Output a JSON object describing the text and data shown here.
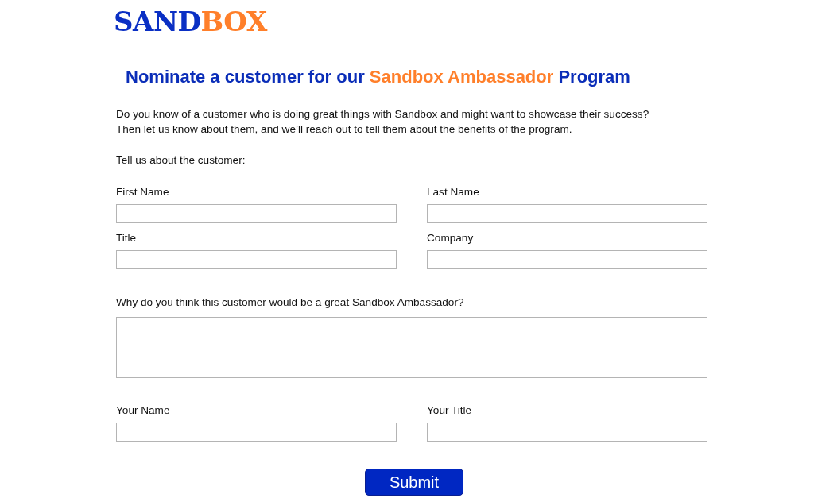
{
  "logo": {
    "parts": [
      {
        "text": "SAND",
        "kind": "primary"
      },
      {
        "text": "BOX",
        "kind": "accent"
      }
    ]
  },
  "heading": {
    "parts": [
      {
        "text": "Nominate a customer for our ",
        "kind": "primary"
      },
      {
        "text": "Sandbox Ambassador",
        "kind": "accent"
      },
      {
        "text": " Program",
        "kind": "primary"
      }
    ]
  },
  "intro": [
    "Do you know of a customer who is doing great things with Sandbox and might want to showcase their success?",
    "Then let us know about them, and we’ll reach out to tell them about the benefits of the program."
  ],
  "customer_section": {
    "title": "Tell us about the customer:",
    "fields": [
      {
        "label": "First Name"
      },
      {
        "label": "Last Name"
      },
      {
        "label": "Title"
      },
      {
        "label": "Company"
      }
    ]
  },
  "question": {
    "label": "Why do you think this customer would be a great Sandbox Ambassador?"
  },
  "nominator_fields": [
    {
      "label": "Your Name"
    },
    {
      "label": "Your Title"
    }
  ],
  "submit": {
    "label": "Submit"
  }
}
